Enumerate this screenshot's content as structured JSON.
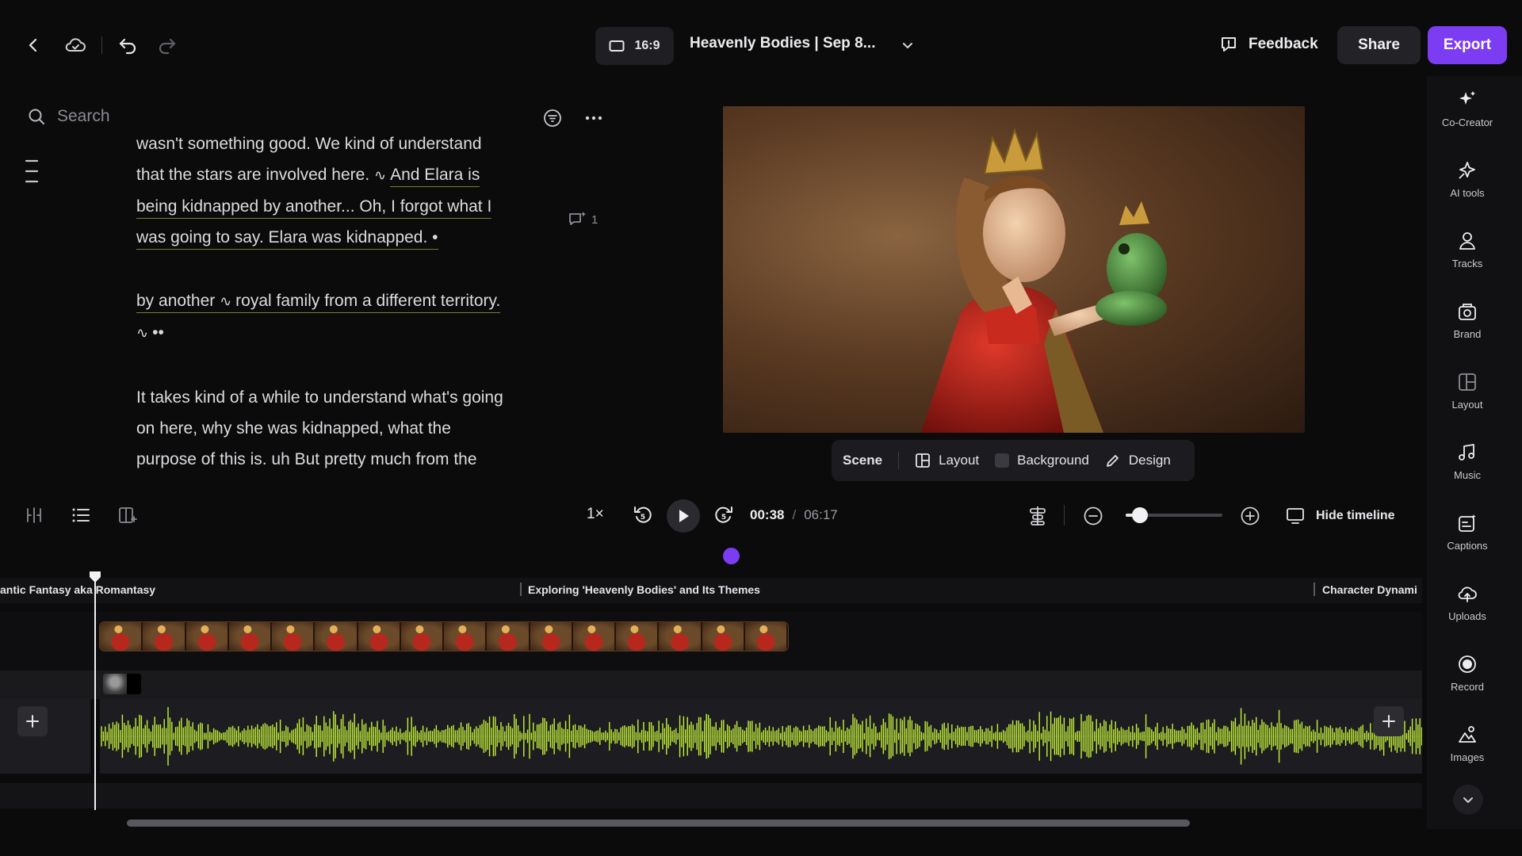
{
  "topbar": {
    "aspect_ratio": "16:9",
    "project_title": "Heavenly Bodies | Sep 8...",
    "feedback_label": "Feedback",
    "share_label": "Share",
    "export_label": "Export",
    "colors": {
      "accent": "#7c3df2"
    }
  },
  "search": {
    "placeholder": "Search",
    "value": ""
  },
  "script": {
    "para1_line1": "wasn't something good. We kind of understand",
    "para1_line2a": "that the stars are involved here. ",
    "para1_line2b": "And Elara is",
    "para1_line3": "being kidnapped by another... Oh, I forgot what I",
    "para1_line4": "was going to say. Elara was kidnapped. •",
    "para2_a": "by another ",
    "para2_b": "royal family from a different territory.",
    "para2_dots": "••",
    "para3_line1": "It takes kind of a while to understand what's going",
    "para3_line2": "on here, why she was kidnapped, what the",
    "para3_line3": "purpose of this is. uh But pretty much from the",
    "comment_count": "1"
  },
  "scene_bar": {
    "scene": "Scene",
    "layout": "Layout",
    "background": "Background",
    "design": "Design"
  },
  "transport": {
    "speed": "1×",
    "current_time": "00:38",
    "duration": "06:17",
    "zoom_level": 0.15,
    "hide_timeline": "Hide timeline"
  },
  "timeline": {
    "chapters": [
      "antic Fantasy aka Romantasy",
      "Exploring 'Heavenly Bodies' and Its Themes",
      "Character Dynami"
    ]
  },
  "rail": {
    "items": [
      {
        "label": "Co-Creator",
        "icon": "sparkle-icon"
      },
      {
        "label": "AI tools",
        "icon": "ai-tools-icon"
      },
      {
        "label": "Tracks",
        "icon": "tracks-icon"
      },
      {
        "label": "Brand",
        "icon": "brand-icon"
      },
      {
        "label": "Layout",
        "icon": "layout-icon"
      },
      {
        "label": "Music",
        "icon": "music-icon"
      },
      {
        "label": "Captions",
        "icon": "captions-icon"
      },
      {
        "label": "Uploads",
        "icon": "upload-icon"
      },
      {
        "label": "Record",
        "icon": "record-icon"
      },
      {
        "label": "Images",
        "icon": "images-icon"
      }
    ]
  }
}
